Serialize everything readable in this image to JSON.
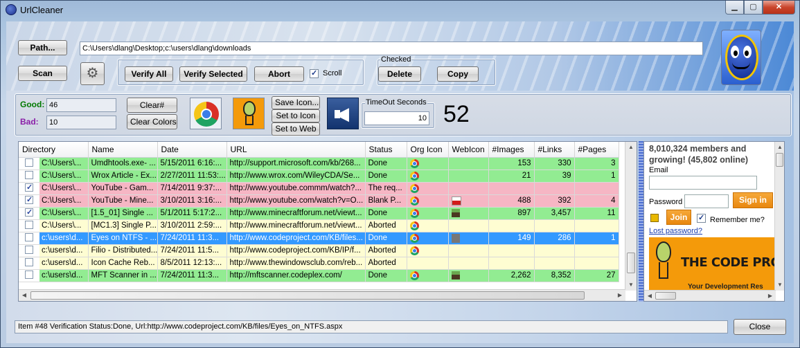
{
  "window": {
    "title": "UrlCleaner"
  },
  "toolbar": {
    "path_label": "Path...",
    "path_value": "C:\\Users\\dlang\\Desktop;c:\\users\\dlang\\downloads",
    "scan_label": "Scan",
    "verify_all_label": "Verify All",
    "verify_selected_label": "Verify Selected",
    "abort_label": "Abort",
    "scroll_label": "Scroll",
    "scroll_checked": true,
    "checked_group_label": "Checked",
    "delete_label": "Delete",
    "copy_label": "Copy"
  },
  "stats": {
    "good_label": "Good:",
    "good_value": "46",
    "bad_label": "Bad:",
    "bad_value": "10",
    "clear_hash_label": "Clear#",
    "clear_colors_label": "Clear Colors",
    "save_icon_label": "Save Icon...",
    "set_to_icon_label": "Set to Icon",
    "set_to_web_label": "Set to Web",
    "timeout_label": "TimeOut Seconds",
    "timeout_value": "10",
    "counter": "52"
  },
  "grid": {
    "columns": [
      "Directory",
      "Name",
      "Date",
      "URL",
      "Status",
      "Org Icon",
      "WebIcon",
      "#Images",
      "#Links",
      "#Pages"
    ],
    "rows": [
      {
        "checked": false,
        "color": "green",
        "dir": "C:\\Users\\...",
        "name": "Umdhtools.exe- ...",
        "date": "5/15/2011 6:16:...",
        "url": "http://support.microsoft.com/kb/268...",
        "status": "Done",
        "org": "chrome",
        "web": "",
        "images": "153",
        "links": "330",
        "pages": "3"
      },
      {
        "checked": false,
        "color": "green",
        "dir": "C:\\Users\\...",
        "name": "Wrox Article - Ex...",
        "date": "2/27/2011 11:53:...",
        "url": "http://www.wrox.com/WileyCDA/Se...",
        "status": "Done",
        "org": "chrome",
        "web": "",
        "images": "21",
        "links": "39",
        "pages": "1"
      },
      {
        "checked": true,
        "color": "pink",
        "dir": "C:\\Users\\...",
        "name": "YouTube - Gam...",
        "date": "7/14/2011 9:37:...",
        "url": "http://www.youtube.commm/watch?...",
        "status": "The req...",
        "org": "chrome",
        "web": "",
        "images": "",
        "links": "",
        "pages": ""
      },
      {
        "checked": true,
        "color": "pink",
        "dir": "C:\\Users\\...",
        "name": "YouTube - Mine...",
        "date": "3/10/2011 3:16:...",
        "url": "http://www.youtube.com/watch?v=O...",
        "status": "Blank P...",
        "org": "chrome",
        "web": "youtube",
        "images": "488",
        "links": "392",
        "pages": "4"
      },
      {
        "checked": true,
        "color": "green",
        "dir": "C:\\Users\\...",
        "name": "[1.5_01] Single ...",
        "date": "5/1/2011 5:17:2...",
        "url": "http://www.minecraftforum.net/viewt...",
        "status": "Done",
        "org": "chrome",
        "web": "minecraft",
        "images": "897",
        "links": "3,457",
        "pages": "11"
      },
      {
        "checked": false,
        "color": "yellow",
        "dir": "C:\\Users\\...",
        "name": "[MC1.3] Single P...",
        "date": "3/10/2011 2:59:...",
        "url": "http://www.minecraftforum.net/viewt...",
        "status": "Aborted",
        "org": "chrome",
        "web": "",
        "images": "",
        "links": "",
        "pages": ""
      },
      {
        "checked": false,
        "color": "sel",
        "dir": "c:\\users\\d...",
        "name": "Eyes on NTFS - ...",
        "date": "7/24/2011 11:3...",
        "url": "http://www.codeproject.com/KB/files...",
        "status": "Done",
        "org": "chrome",
        "web": "codeproject",
        "images": "149",
        "links": "286",
        "pages": "1"
      },
      {
        "checked": false,
        "color": "yellow",
        "dir": "c:\\users\\d...",
        "name": "Filio - Distributed...",
        "date": "7/24/2011 11:5...",
        "url": "http://www.codeproject.com/KB/IP/f...",
        "status": "Aborted",
        "org": "chrome",
        "web": "",
        "images": "",
        "links": "",
        "pages": ""
      },
      {
        "checked": false,
        "color": "yellow",
        "dir": "c:\\users\\d...",
        "name": "Icon Cache Reb...",
        "date": "8/5/2011 12:13:...",
        "url": "http://www.thewindowsclub.com/reb...",
        "status": "Aborted",
        "org": "",
        "web": "",
        "images": "",
        "links": "",
        "pages": ""
      },
      {
        "checked": false,
        "color": "green",
        "dir": "c:\\users\\d...",
        "name": "MFT Scanner in ...",
        "date": "7/24/2011 11:3...",
        "url": "http://mftscanner.codeplex.com/",
        "status": "Done",
        "org": "chrome",
        "web": "minecraft",
        "images": "2,262",
        "links": "8,352",
        "pages": "27"
      }
    ]
  },
  "web": {
    "members_line1": "8,010,324 members and",
    "members_line2": "growing! (45,802 online)",
    "email_label": "Email",
    "password_label": "Password",
    "sign_in_label": "Sign in",
    "join_label": "Join",
    "remember_label": "Remember me?",
    "lost_password_label": "Lost password?",
    "banner_text": "THE CODE PROJ",
    "banner_sub": "Your Development Res"
  },
  "status": {
    "text": "Item #48 Verification Status:Done, Url:http://www.codeproject.com/KB/files/Eyes_on_NTFS.aspx",
    "close_label": "Close"
  },
  "colors": {
    "good": "#007a00",
    "bad": "#8a1ea8",
    "row_green": "#92ec92",
    "row_pink": "#f6b6c4",
    "row_yellow": "#fefdd2",
    "row_selected": "#3399ff"
  }
}
